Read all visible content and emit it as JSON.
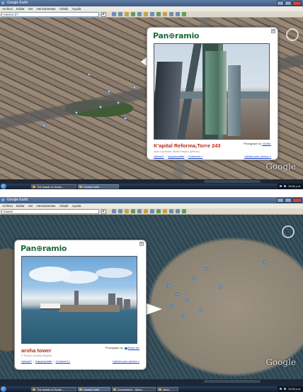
{
  "shot1": {
    "window_title": "Google Earth",
    "menu": [
      "Archivo",
      "Editar",
      "Ver",
      "Herramientas",
      "Añadir",
      "Ayuda"
    ],
    "search_value": "mexico d f",
    "balloon": {
      "logo": "Pan⊕ramio",
      "photo_title": "K'apital Reforma,Torre 243",
      "photographer_prefix": "Photograph by",
      "photographer": "<Sofi9>",
      "meta": "Jaan Leydecker, Martin Palacio (México)",
      "links": [
        "Upload?",
        "Inappropriate",
        "Comment »"
      ],
      "upload": "Upload your photos »"
    },
    "watermark": "Google",
    "taskbar": [
      "The beauty of Googl...",
      "Google Earth"
    ],
    "clock": "10:54 p.m."
  },
  "shot2": {
    "window_title": "Google Earth",
    "menu": [
      "Archivo",
      "Editar",
      "Ver",
      "Herramientas",
      "Añadir",
      "Ayuda"
    ],
    "search_value": "hawaii",
    "balloon": {
      "logo": "Pan⊕ramio",
      "photo_title": "aroha tower",
      "photographer_prefix": "Photograph by",
      "photographer": "Ethan KH",
      "meta": "© Photos of Aloha Stadium",
      "links": [
        "Upload?",
        "Inappropriate",
        "Comment »"
      ],
      "upload": "Upload your photos »"
    },
    "watermark": "Google",
    "taskbar": [
      "The beauty of Googl...",
      "Google Earth",
      "Documento1 - Micro...",
      "Wind..."
    ],
    "clock": "10:53 p.m."
  }
}
